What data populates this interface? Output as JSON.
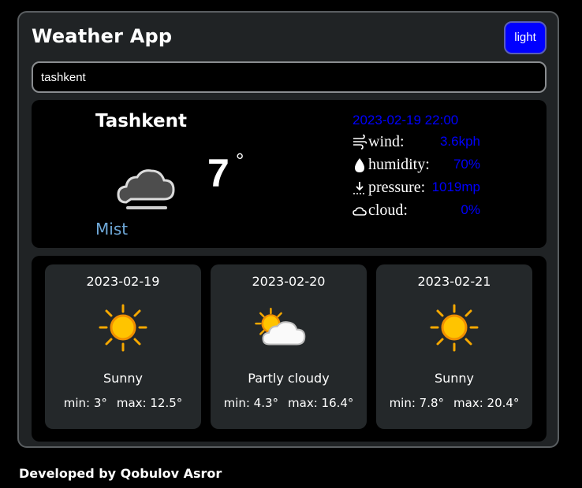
{
  "app": {
    "title": "Weather App",
    "theme_button": "light"
  },
  "search": {
    "value": "tashkent"
  },
  "current": {
    "city": "Tashkent",
    "temperature": "7",
    "degree": "°",
    "condition": "Mist",
    "datetime": "2023-02-19 22:00",
    "details": [
      {
        "icon": "wind-icon",
        "label": "wind:",
        "value": "3.6kph"
      },
      {
        "icon": "humidity-drop-icon",
        "label": "humidity:",
        "value": "70%"
      },
      {
        "icon": "pressure-icon",
        "label": "pressure:",
        "value": "1019mp"
      },
      {
        "icon": "cloud-outline-icon",
        "label": "cloud:",
        "value": "0%"
      }
    ]
  },
  "forecast": [
    {
      "date": "2023-02-19",
      "icon": "sun-icon",
      "condition": "Sunny",
      "min": "min: 3°",
      "max": "max: 12.5°"
    },
    {
      "date": "2023-02-20",
      "icon": "partly-cloudy-icon",
      "condition": "Partly cloudy",
      "min": "min: 4.3°",
      "max": "max: 16.4°"
    },
    {
      "date": "2023-02-21",
      "icon": "sun-icon",
      "condition": "Sunny",
      "min": "min: 7.8°",
      "max": "max: 20.4°"
    }
  ],
  "footer": {
    "text": "Developed by Qobulov Asror"
  },
  "colors": {
    "accent": "#0000ff",
    "panel": "#202325",
    "card": "#24282a",
    "condition_text": "#6ea8d8"
  }
}
